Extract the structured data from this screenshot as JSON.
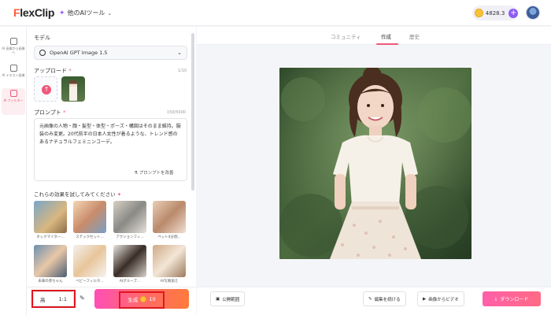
{
  "header": {
    "logo_prefix": "F",
    "logo_rest": "lexClip",
    "ai_tools_label": "他のAIツール",
    "credits": "4828.3"
  },
  "rail": {
    "items": [
      {
        "label": "AI 画像から画像へ"
      },
      {
        "label": "AI テキスト画像"
      },
      {
        "label": "AI フィルター"
      }
    ]
  },
  "panel": {
    "model_label": "モデル",
    "model_value": "OpenAI GPT Image 1.5",
    "upload_label": "アップロード",
    "upload_count": "1/10",
    "prompt_label": "プロンプト",
    "prompt_count": "150/5000",
    "prompt_text": "元画像の人物・顔・髪型・体型・ポーズ・構図はそのまま維持。服装のみ変更。20代前半の日本人女性が着るような、トレンド感のあるナチュラルフェミニンコーデ。",
    "improve_label": "プロンプトを改善",
    "effects_title": "これらの効果を試してみてください",
    "effects": [
      {
        "label": "ネックマイター..."
      },
      {
        "label": "ステックセット..."
      },
      {
        "label": "アクションフィ..."
      },
      {
        "label": "ペット4分割..."
      },
      {
        "label": "未来の赤ちゃん"
      },
      {
        "label": "ベビーフィルタ..."
      },
      {
        "label": "AIグループ..."
      },
      {
        "label": "AI写真加え"
      }
    ]
  },
  "bottom": {
    "quality": "高",
    "ratio": "1:1",
    "generate_label": "生成",
    "generate_cost": "10",
    "public_scope": "公開範囲",
    "continue_edit": "編集を続ける",
    "image_to_video": "画像からビデオ",
    "download": "ダウンロード"
  },
  "tabs": [
    {
      "label": "コミュニティ"
    },
    {
      "label": "作成"
    },
    {
      "label": "歴史"
    }
  ],
  "colors": {
    "accent": "#f0577a",
    "highlight": "#e0161f"
  }
}
